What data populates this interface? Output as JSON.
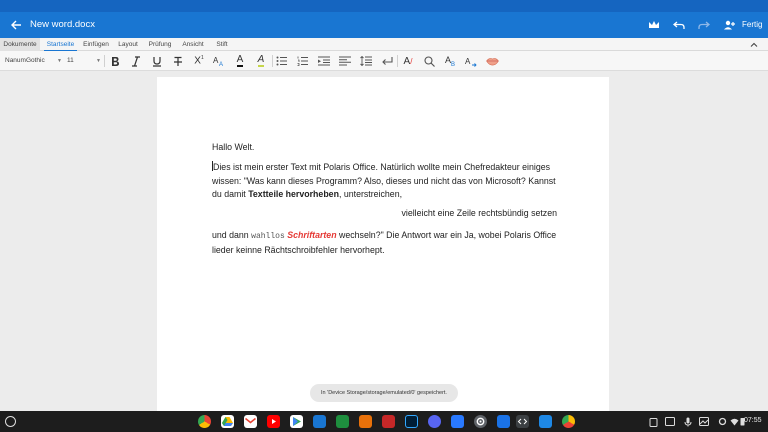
{
  "window": {
    "title": "New word.docx",
    "done_label": "Fertig"
  },
  "tabs": [
    {
      "label": "Dokumente"
    },
    {
      "label": "Startseite"
    },
    {
      "label": "Einfügen"
    },
    {
      "label": "Layout"
    },
    {
      "label": "Prüfung"
    },
    {
      "label": "Ansicht"
    },
    {
      "label": "Stift"
    }
  ],
  "toolbar": {
    "font_name": "NanumGothic",
    "font_size": "11",
    "superscript_label": "X",
    "superscript_mark": "1",
    "font_color_label": "A",
    "highlight_label": "A",
    "spellcheck_label": "A",
    "replace_label": "A",
    "replace_sub": "B"
  },
  "colors": {
    "title_bar": "#1976d2",
    "status_bar": "#1565c0",
    "accent_red": "#e53935",
    "shelf": "#1d1d1d"
  },
  "document": {
    "p1": "Hallo Welt.",
    "p2_text": "Dies ist mein erster Text mit Polaris Office. Natürlich wollte mein Chefredakteur einiges wissen: \"Was kann dieses Programm? Also, dieses und nicht das von Microsoft? Kannst du damit ",
    "p2_bold": "Textteile hervorheben",
    "p2_end": ", unterstreichen,",
    "p3": "vielleicht eine Zeile rechtsbündig setzen",
    "p4_start": "und dann ",
    "p4_mono": "wahllos",
    "p4_red": "Schriftarten",
    "p4_end": " wechseln?\"  Die Antwort war ein Ja, wobei Polaris Office lieder keinne Rächtschroibfehler hervorhept."
  },
  "toast": {
    "text": "In 'Device Storage/storage/emulated/0' gespeichert."
  },
  "shelf": {
    "apps": [
      "chrome",
      "google-drive",
      "gmail",
      "youtube",
      "google-play",
      "polaris-office",
      "spreadsheet",
      "presentation",
      "photoshop",
      "discord",
      "chromebook-app",
      "settings",
      "files-app",
      "code-app",
      "files",
      "chrome-canary"
    ],
    "time": "07:55"
  }
}
